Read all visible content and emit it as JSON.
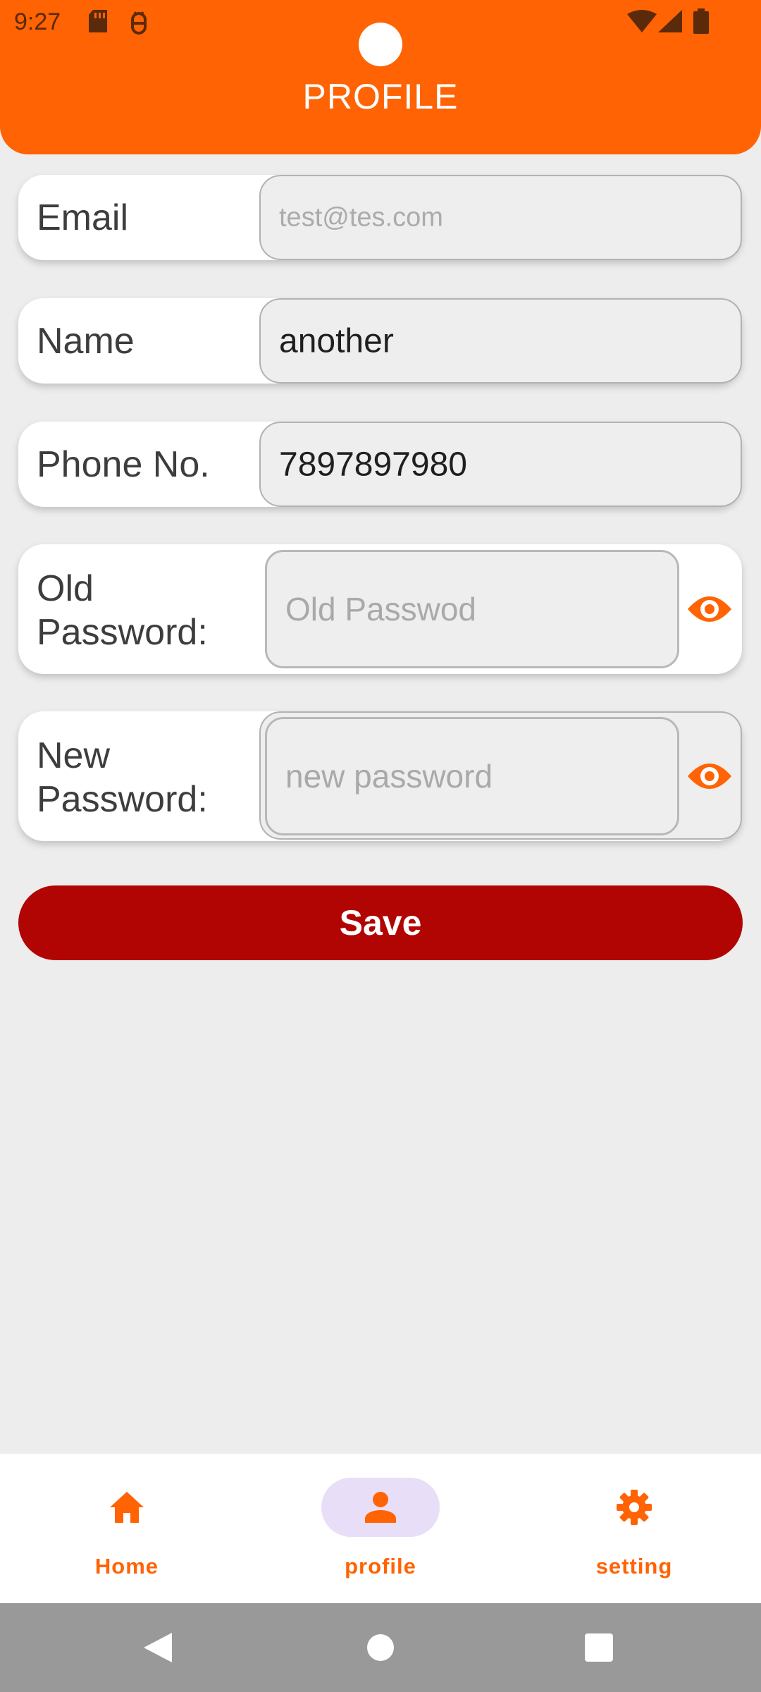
{
  "status_bar": {
    "time": "9:27",
    "icons": [
      "sd-card-icon",
      "debug-icon",
      "wifi-icon",
      "signal-icon",
      "battery-icon"
    ]
  },
  "header": {
    "title": "PROFILE",
    "background_color": "#ff6303"
  },
  "form": {
    "email": {
      "label": "Email",
      "placeholder": "test@tes.com",
      "value": ""
    },
    "name": {
      "label": "Name",
      "value": "another"
    },
    "phone": {
      "label": "Phone No.",
      "value": "7897897980"
    },
    "old_password": {
      "label_line1": "Old",
      "label_line2": "Password:",
      "placeholder": "Old Passwod",
      "toggle_icon": "eye-icon"
    },
    "new_password": {
      "label_line1": "New",
      "label_line2": "Password:",
      "placeholder": "new password",
      "toggle_icon": "eye-icon"
    }
  },
  "actions": {
    "save_label": "Save",
    "save_color": "#b10503"
  },
  "bottom_nav": {
    "items": [
      {
        "label": "Home",
        "icon": "home-icon",
        "active": false
      },
      {
        "label": "profile",
        "icon": "person-icon",
        "active": true
      },
      {
        "label": "setting",
        "icon": "gear-icon",
        "active": false
      }
    ],
    "accent_color": "#ff6303",
    "active_pill_color": "#e9def8"
  },
  "system_nav": {
    "buttons": [
      "back-icon",
      "home-circle-icon",
      "recents-icon"
    ]
  }
}
